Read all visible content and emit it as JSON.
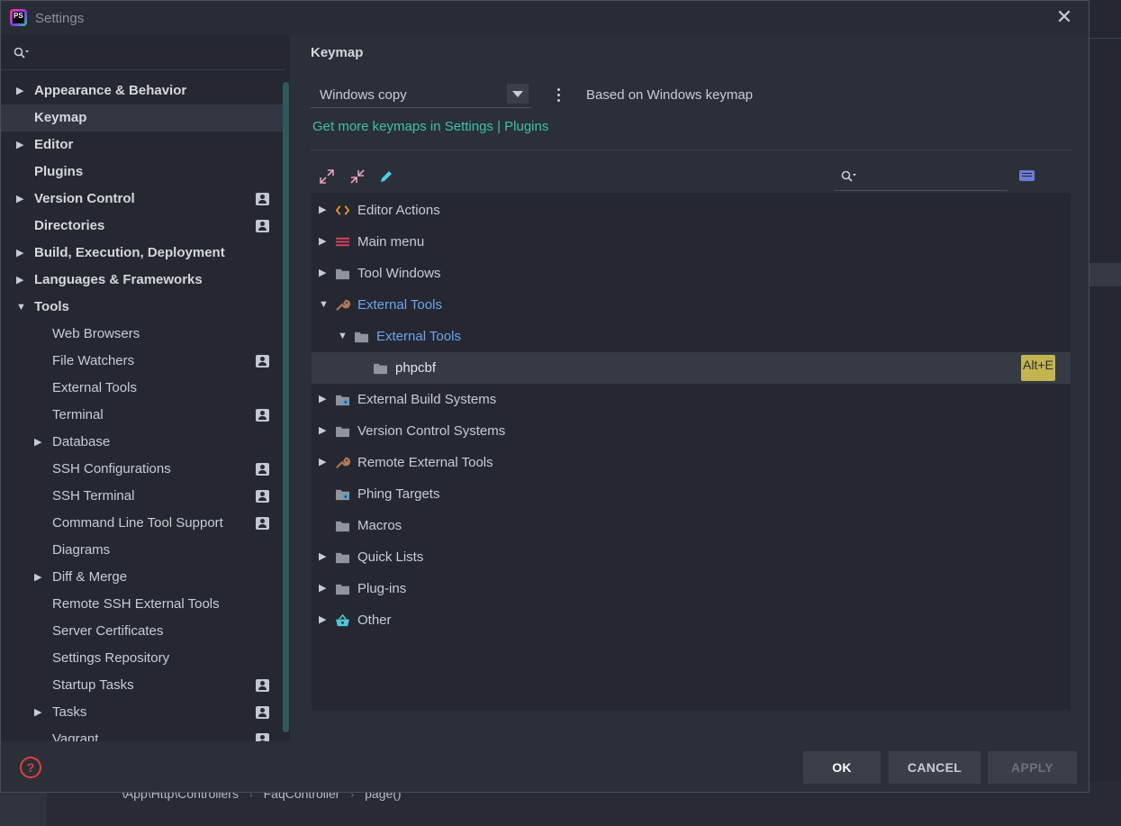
{
  "window": {
    "title": "Settings",
    "app_icon_text": "PS"
  },
  "background": {
    "breadcrumb": [
      "\\App\\Http\\Controllers",
      "FaqController",
      "page()"
    ],
    "breadcrumb_sep": "›"
  },
  "sidebar": {
    "search_placeholder": "",
    "items": [
      {
        "label": "Appearance & Behavior",
        "expandable": true,
        "expanded": false,
        "bold": true,
        "project": false,
        "level": 0
      },
      {
        "label": "Keymap",
        "expandable": false,
        "bold": true,
        "project": false,
        "level": 0,
        "selected": true
      },
      {
        "label": "Editor",
        "expandable": true,
        "expanded": false,
        "bold": true,
        "project": false,
        "level": 0
      },
      {
        "label": "Plugins",
        "expandable": false,
        "bold": true,
        "project": false,
        "level": 0
      },
      {
        "label": "Version Control",
        "expandable": true,
        "expanded": false,
        "bold": true,
        "project": true,
        "level": 0
      },
      {
        "label": "Directories",
        "expandable": false,
        "bold": true,
        "project": true,
        "level": 0
      },
      {
        "label": "Build, Execution, Deployment",
        "expandable": true,
        "expanded": false,
        "bold": true,
        "project": false,
        "level": 0
      },
      {
        "label": "Languages & Frameworks",
        "expandable": true,
        "expanded": false,
        "bold": true,
        "project": false,
        "level": 0
      },
      {
        "label": "Tools",
        "expandable": true,
        "expanded": true,
        "bold": true,
        "project": false,
        "level": 0
      },
      {
        "label": "Web Browsers",
        "expandable": false,
        "bold": false,
        "project": false,
        "level": 1
      },
      {
        "label": "File Watchers",
        "expandable": false,
        "bold": false,
        "project": true,
        "level": 1
      },
      {
        "label": "External Tools",
        "expandable": false,
        "bold": false,
        "project": false,
        "level": 1
      },
      {
        "label": "Terminal",
        "expandable": false,
        "bold": false,
        "project": true,
        "level": 1
      },
      {
        "label": "Database",
        "expandable": true,
        "expanded": false,
        "bold": false,
        "project": false,
        "level": 1
      },
      {
        "label": "SSH Configurations",
        "expandable": false,
        "bold": false,
        "project": true,
        "level": 1
      },
      {
        "label": "SSH Terminal",
        "expandable": false,
        "bold": false,
        "project": true,
        "level": 1
      },
      {
        "label": "Command Line Tool Support",
        "expandable": false,
        "bold": false,
        "project": true,
        "level": 1
      },
      {
        "label": "Diagrams",
        "expandable": false,
        "bold": false,
        "project": false,
        "level": 1
      },
      {
        "label": "Diff & Merge",
        "expandable": true,
        "expanded": false,
        "bold": false,
        "project": false,
        "level": 1
      },
      {
        "label": "Remote SSH External Tools",
        "expandable": false,
        "bold": false,
        "project": false,
        "level": 1
      },
      {
        "label": "Server Certificates",
        "expandable": false,
        "bold": false,
        "project": false,
        "level": 1
      },
      {
        "label": "Settings Repository",
        "expandable": false,
        "bold": false,
        "project": false,
        "level": 1
      },
      {
        "label": "Startup Tasks",
        "expandable": false,
        "bold": false,
        "project": true,
        "level": 1
      },
      {
        "label": "Tasks",
        "expandable": true,
        "expanded": false,
        "bold": false,
        "project": true,
        "level": 1
      },
      {
        "label": "Vagrant",
        "expandable": false,
        "bold": false,
        "project": true,
        "level": 1
      }
    ]
  },
  "main": {
    "title": "Keymap",
    "keymap_selected": "Windows copy",
    "based_on": "Based on Windows keymap",
    "more_link": "Get more keymaps in Settings | Plugins",
    "filter_placeholder": "",
    "tree": [
      {
        "label": "Editor Actions",
        "level": 0,
        "arrow": "collapsed",
        "icon": "code-brackets-icon",
        "style": "normal"
      },
      {
        "label": "Main menu",
        "level": 0,
        "arrow": "collapsed",
        "icon": "menu-icon",
        "style": "normal"
      },
      {
        "label": "Tool Windows",
        "level": 0,
        "arrow": "collapsed",
        "icon": "folder-icon",
        "style": "normal"
      },
      {
        "label": "External Tools",
        "level": 0,
        "arrow": "expanded",
        "icon": "wrench-icon",
        "style": "blue"
      },
      {
        "label": "External Tools",
        "level": 1,
        "arrow": "expanded",
        "icon": "folder-icon",
        "style": "blue"
      },
      {
        "label": "phpcbf",
        "level": 2,
        "arrow": "none",
        "icon": "folder-icon",
        "style": "white",
        "selected": true,
        "shortcut": "Alt+E"
      },
      {
        "label": "External Build Systems",
        "level": 0,
        "arrow": "collapsed",
        "icon": "folder-gear-icon",
        "style": "normal"
      },
      {
        "label": "Version Control Systems",
        "level": 0,
        "arrow": "collapsed",
        "icon": "folder-icon",
        "style": "normal"
      },
      {
        "label": "Remote External Tools",
        "level": 0,
        "arrow": "collapsed",
        "icon": "wrench-icon",
        "style": "normal"
      },
      {
        "label": "Phing Targets",
        "level": 0,
        "arrow": "none",
        "icon": "folder-gear-icon",
        "style": "normal"
      },
      {
        "label": "Macros",
        "level": 0,
        "arrow": "none",
        "icon": "folder-icon",
        "style": "normal"
      },
      {
        "label": "Quick Lists",
        "level": 0,
        "arrow": "collapsed",
        "icon": "folder-icon",
        "style": "normal"
      },
      {
        "label": "Plug-ins",
        "level": 0,
        "arrow": "collapsed",
        "icon": "folder-icon",
        "style": "normal"
      },
      {
        "label": "Other",
        "level": 0,
        "arrow": "collapsed",
        "icon": "basket-icon",
        "style": "normal"
      }
    ]
  },
  "footer": {
    "ok": "OK",
    "cancel": "CANCEL",
    "apply": "APPLY"
  },
  "colors": {
    "accent_link": "#3fc1a8",
    "selected_blue": "#6ea3f0",
    "shortcut_bg": "#c4b44f",
    "help_red": "#e0403f"
  }
}
